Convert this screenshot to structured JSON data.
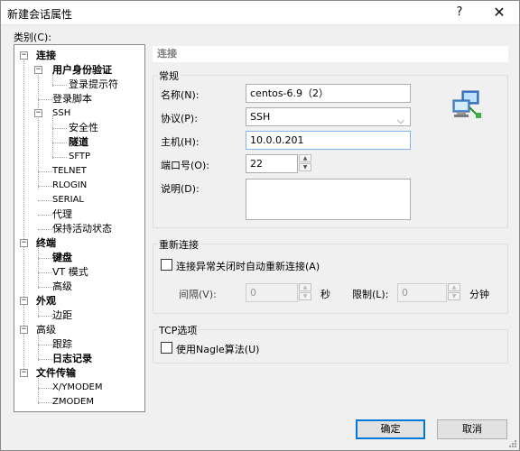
{
  "window": {
    "title": "新建会话属性",
    "help_glyph": "?",
    "close_glyph": "✕"
  },
  "category_label": "类别(C):",
  "tree": {
    "connection": "连接",
    "user_auth": "用户身份验证",
    "login_prompt": "登录提示符",
    "login_script": "登录脚本",
    "ssh": "SSH",
    "security": "安全性",
    "tunnel": "隧道",
    "sftp": "SFTP",
    "telnet": "TELNET",
    "rlogin": "RLOGIN",
    "serial": "SERIAL",
    "proxy": "代理",
    "keepalive": "保持活动状态",
    "terminal": "终端",
    "keyboard": "键盘",
    "vt_mode": "VT 模式",
    "advanced": "高级",
    "appearance": "外观",
    "margin": "边距",
    "advanced2": "高级",
    "trace": "跟踪",
    "logging": "日志记录",
    "file_transfer": "文件传输",
    "xymodem": "X/YMODEM",
    "zmodem": "ZMODEM"
  },
  "panel_header": "连接",
  "general": {
    "title": "常规",
    "name_label": "名称(N):",
    "name_value": "centos-6.9（2）",
    "protocol_label": "协议(P):",
    "protocol_value": "SSH",
    "host_label": "主机(H):",
    "host_value": "10.0.0.201",
    "port_label": "端口号(O):",
    "port_value": "22",
    "desc_label": "说明(D):",
    "desc_value": ""
  },
  "reconnect": {
    "title": "重新连接",
    "auto_label": "连接异常关闭时自动重新连接(A)",
    "interval_label": "间隔(V):",
    "interval_value": "0",
    "seconds_label": "秒",
    "limit_label": "限制(L):",
    "limit_value": "0",
    "minutes_label": "分钟"
  },
  "tcp": {
    "title": "TCP选项",
    "nagle_label": "使用Nagle算法(U)"
  },
  "buttons": {
    "ok": "确定",
    "cancel": "取消"
  },
  "colors": {
    "accent": "#0078d7",
    "panel_bg": "#f0f0f0"
  }
}
